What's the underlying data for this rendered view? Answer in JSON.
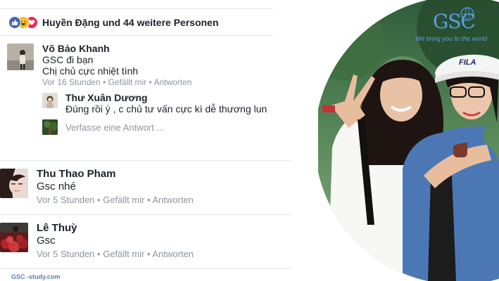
{
  "reactions": {
    "icons": [
      "like-icon",
      "haha-icon",
      "love-icon"
    ],
    "text": "Huyền Đặng und 44 weitere Personen"
  },
  "comments": [
    {
      "name": "Võ Bảo Khanh",
      "lines": [
        "GSC đi bạn",
        "Chị chủ cực nhiệt tình"
      ],
      "time": "Vor 16 Stunden",
      "like": "Gefällt mir",
      "reply": "Antworten",
      "replies": [
        {
          "name": "Thư Xuân Dương",
          "text": "Đúng rồi ý , c chủ tư vấn cực kì dễ thương lun"
        }
      ],
      "reply_placeholder": "Verfasse eine Antwort ..."
    },
    {
      "name": "Thu Thao Pham",
      "text": "Gsc nhé",
      "time": "Vor 5 Stunden",
      "like": "Gefällt mir",
      "reply": "Antworten"
    },
    {
      "name": "Lê Thuỳ",
      "text": "Gsc",
      "time": "Vor 5 Stunden",
      "like": "Gefällt mir",
      "reply": "Antworten"
    }
  ],
  "overlay": {
    "logo": "GSC",
    "slogan": "We bring you to the world",
    "shirt_brand": "FILA"
  },
  "watermark": "GSC -study.com",
  "separator": " • "
}
